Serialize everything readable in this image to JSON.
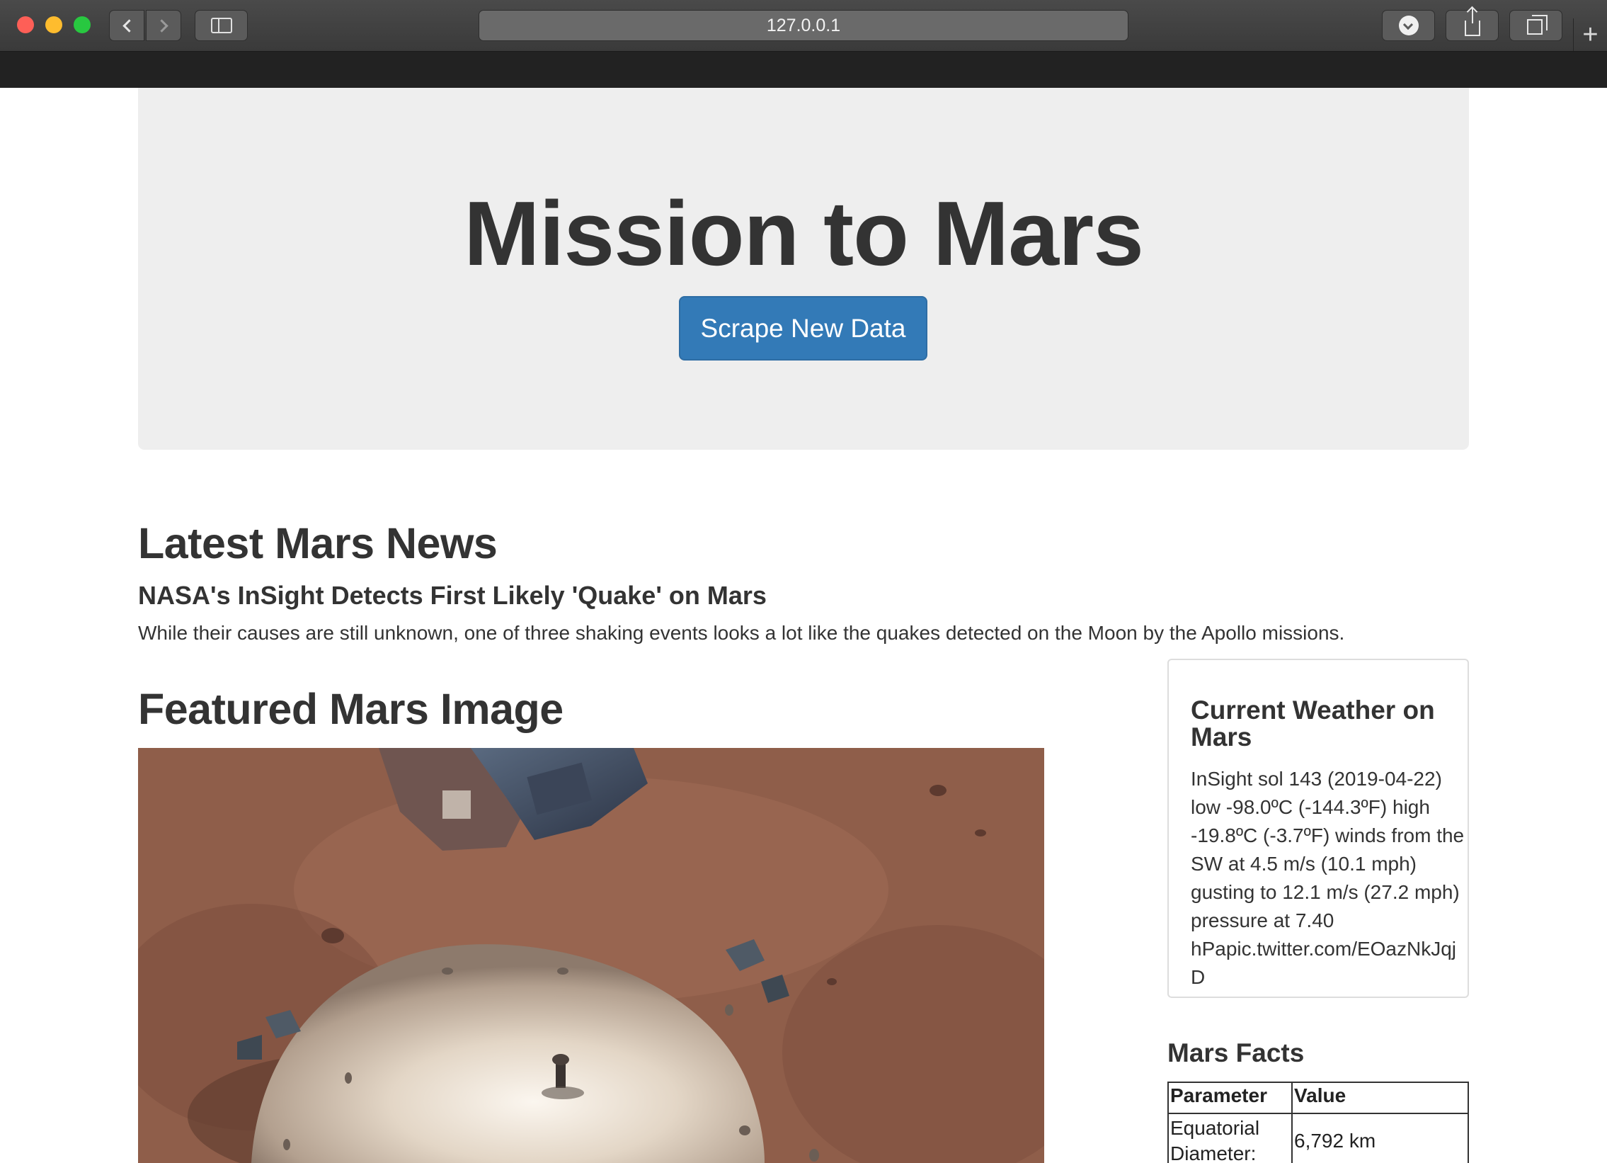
{
  "browser": {
    "url": "127.0.0.1",
    "icons": {
      "back": "chevron-left-icon",
      "forward": "chevron-right-icon",
      "sidebar": "sidebar-icon",
      "download": "download-icon",
      "share": "share-icon",
      "tabs": "tabs-overview-icon",
      "new_tab": "plus-icon"
    },
    "new_tab_glyph": "+"
  },
  "jumbotron": {
    "title": "Mission to Mars",
    "button_label": "Scrape New Data",
    "button_color": "#337ab7"
  },
  "news": {
    "heading": "Latest Mars News",
    "title": "NASA's InSight Detects First Likely 'Quake' on Mars",
    "paragraph": "While their causes are still unknown, one of three shaking events looks a lot like the quakes detected on the Moon by the Apollo missions."
  },
  "featured": {
    "heading": "Featured Mars Image"
  },
  "weather": {
    "heading": "Current Weather on Mars",
    "text": "InSight sol 143 (2019-04-22) low -98.0ºC (-144.3ºF) high -19.8ºC (-3.7ºF) winds from the SW at 4.5 m/s (10.1 mph) gusting to 12.1 m/s (27.2 mph) pressure at 7.40 hPapic.twitter.com/EOazNkJqjD"
  },
  "facts": {
    "heading": "Mars Facts",
    "columns": [
      "Parameter",
      "Value"
    ],
    "rows": [
      {
        "parameter": "Equatorial Diameter:",
        "value": "6,792 km"
      }
    ]
  }
}
